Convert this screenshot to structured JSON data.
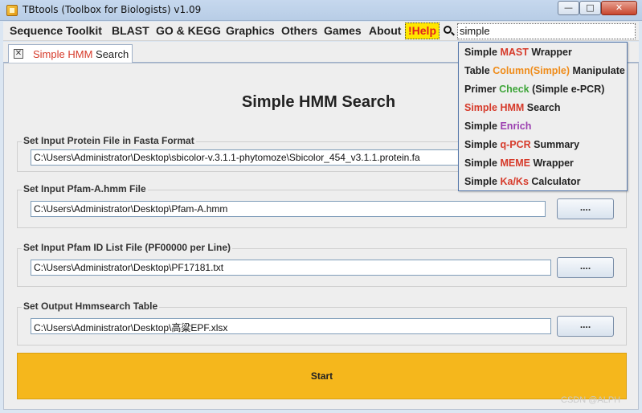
{
  "window": {
    "title": "TBtools (Toolbox for Biologists) v1.09",
    "min_glyph": "—",
    "max_glyph": "□",
    "close_glyph": "✕"
  },
  "menu": {
    "items": [
      "Sequence Toolkit",
      "BLAST",
      "GO & KEGG",
      "Graphics",
      "Others",
      "Games",
      "About"
    ],
    "help": "!Help",
    "search_value": "simple"
  },
  "tab": {
    "close_glyph": "✕",
    "label_red": "Simple HMM",
    "label_rest": " Search"
  },
  "main": {
    "title": "Simple HMM Search",
    "groups": [
      {
        "label": "Set Input Protein File in Fasta Format",
        "value": "C:\\Users\\Administrator\\Desktop\\sbicolor-v.3.1.1-phytomoze\\Sbicolor_454_v3.1.1.protein.fa",
        "button": "...."
      },
      {
        "label": "Set Input Pfam-A.hmm File",
        "value": "C:\\Users\\Administrator\\Desktop\\Pfam-A.hmm",
        "button": "...."
      },
      {
        "label": "Set Input Pfam ID List File (PF00000 per Line)",
        "value": "C:\\Users\\Administrator\\Desktop\\PF17181.txt",
        "button": "...."
      },
      {
        "label": "Set Output Hmmsearch Table",
        "value": "C:\\Users\\Administrator\\Desktop\\高粱EPF.xlsx",
        "button": "...."
      }
    ],
    "start_label": "Start"
  },
  "dropdown": {
    "items": [
      {
        "parts": [
          "Simple ",
          "MAST",
          " Wrapper"
        ]
      },
      {
        "parts": [
          "Table ",
          "Column(Simple)",
          " Manipulate"
        ]
      },
      {
        "parts": [
          "Primer ",
          "Check",
          " (Simple e-PCR)"
        ]
      },
      {
        "parts": [
          "Simple HMM",
          " Search"
        ]
      },
      {
        "parts": [
          "Simple ",
          "Enrich"
        ]
      },
      {
        "parts": [
          "Simple ",
          "q-PCR",
          " Summary"
        ]
      },
      {
        "parts": [
          "Simple ",
          "MEME",
          " Wrapper"
        ]
      },
      {
        "parts": [
          "Simple ",
          "Ka/Ks",
          " Calculator"
        ]
      }
    ]
  },
  "watermark": "CSDN @ALPH",
  "colors": {
    "accent_red": "#d63a2a",
    "help_bg": "#ffe600",
    "start_bg": "#f5b71c",
    "orange": "#ef8c1a",
    "green": "#3fa53a",
    "purple": "#9b3fb0"
  }
}
